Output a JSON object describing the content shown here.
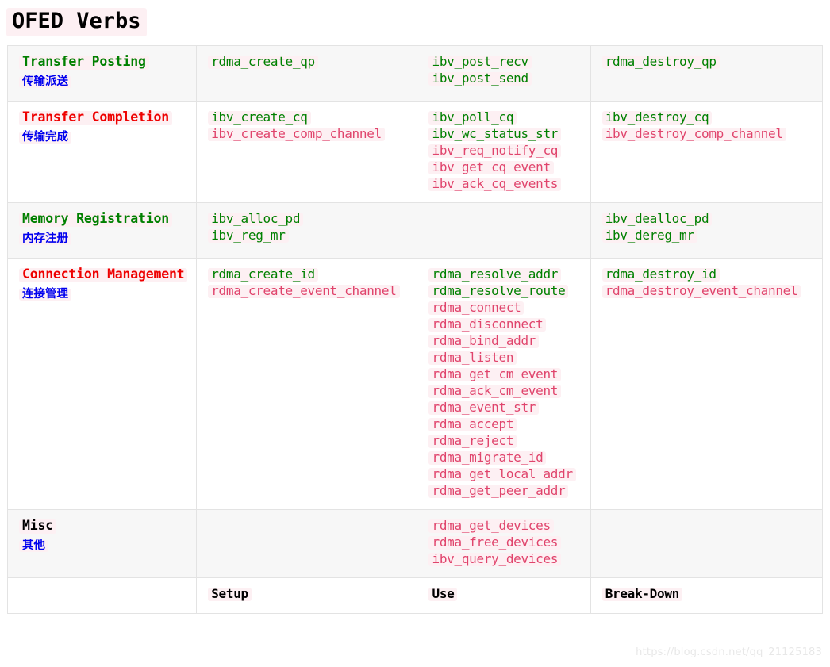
{
  "page": {
    "title": "OFED Verbs",
    "watermark": "https://blog.csdn.net/qq_21125183"
  },
  "footer": {
    "category": "",
    "setup": "Setup",
    "use": "Use",
    "breakdown": "Break-Down"
  },
  "colors": {
    "green": "#008000",
    "crimson": "#e0446c",
    "red": "#ee0000",
    "blue": "#0000ee",
    "black": "#000000",
    "chip_bg": "#fdf0f3",
    "stripe_bg": "#f7f7f7",
    "border": "#e3e3e3"
  },
  "rows": [
    {
      "category_en": "Transfer Posting",
      "category_en_color": "green",
      "category_zh": "传输派送",
      "setup": [
        {
          "name": "rdma_create_qp",
          "color": "green"
        }
      ],
      "use": [
        {
          "name": "ibv_post_recv",
          "color": "green"
        },
        {
          "name": "ibv_post_send",
          "color": "green"
        }
      ],
      "breakdown": [
        {
          "name": "rdma_destroy_qp",
          "color": "green"
        }
      ]
    },
    {
      "category_en": "Transfer Completion",
      "category_en_color": "red",
      "category_zh": "传输完成",
      "setup": [
        {
          "name": "ibv_create_cq",
          "color": "green"
        },
        {
          "name": "ibv_create_comp_channel",
          "color": "crimson"
        }
      ],
      "use": [
        {
          "name": "ibv_poll_cq",
          "color": "green"
        },
        {
          "name": "ibv_wc_status_str",
          "color": "green"
        },
        {
          "name": "ibv_req_notify_cq",
          "color": "crimson"
        },
        {
          "name": "ibv_get_cq_event",
          "color": "crimson"
        },
        {
          "name": "ibv_ack_cq_events",
          "color": "crimson"
        }
      ],
      "breakdown": [
        {
          "name": "ibv_destroy_cq",
          "color": "green"
        },
        {
          "name": "ibv_destroy_comp_channel",
          "color": "crimson"
        }
      ]
    },
    {
      "category_en": "Memory Registration",
      "category_en_color": "green",
      "category_zh": "内存注册",
      "setup": [
        {
          "name": "ibv_alloc_pd",
          "color": "green"
        },
        {
          "name": "ibv_reg_mr",
          "color": "green"
        }
      ],
      "use": [],
      "breakdown": [
        {
          "name": "ibv_dealloc_pd",
          "color": "green"
        },
        {
          "name": "ibv_dereg_mr",
          "color": "green"
        }
      ]
    },
    {
      "category_en": "Connection Management",
      "category_en_color": "red",
      "category_zh": "连接管理",
      "setup": [
        {
          "name": "rdma_create_id",
          "color": "green"
        },
        {
          "name": "rdma_create_event_channel",
          "color": "crimson"
        }
      ],
      "use": [
        {
          "name": "rdma_resolve_addr",
          "color": "green"
        },
        {
          "name": "rdma_resolve_route",
          "color": "green"
        },
        {
          "name": "rdma_connect",
          "color": "crimson"
        },
        {
          "name": "rdma_disconnect",
          "color": "crimson"
        },
        {
          "name": "rdma_bind_addr",
          "color": "crimson"
        },
        {
          "name": "rdma_listen",
          "color": "crimson"
        },
        {
          "name": "rdma_get_cm_event",
          "color": "crimson"
        },
        {
          "name": "rdma_ack_cm_event",
          "color": "crimson"
        },
        {
          "name": "rdma_event_str",
          "color": "crimson"
        },
        {
          "name": "rdma_accept",
          "color": "crimson"
        },
        {
          "name": "rdma_reject",
          "color": "crimson"
        },
        {
          "name": "rdma_migrate_id",
          "color": "crimson"
        },
        {
          "name": "rdma_get_local_addr",
          "color": "crimson"
        },
        {
          "name": "rdma_get_peer_addr",
          "color": "crimson"
        }
      ],
      "breakdown": [
        {
          "name": "rdma_destroy_id",
          "color": "green"
        },
        {
          "name": "rdma_destroy_event_channel",
          "color": "crimson"
        }
      ]
    },
    {
      "category_en": "Misc",
      "category_en_color": "black",
      "category_zh": "其他",
      "setup": [],
      "use": [
        {
          "name": "rdma_get_devices",
          "color": "crimson"
        },
        {
          "name": "rdma_free_devices",
          "color": "crimson"
        },
        {
          "name": "ibv_query_devices",
          "color": "crimson"
        }
      ],
      "breakdown": []
    }
  ]
}
